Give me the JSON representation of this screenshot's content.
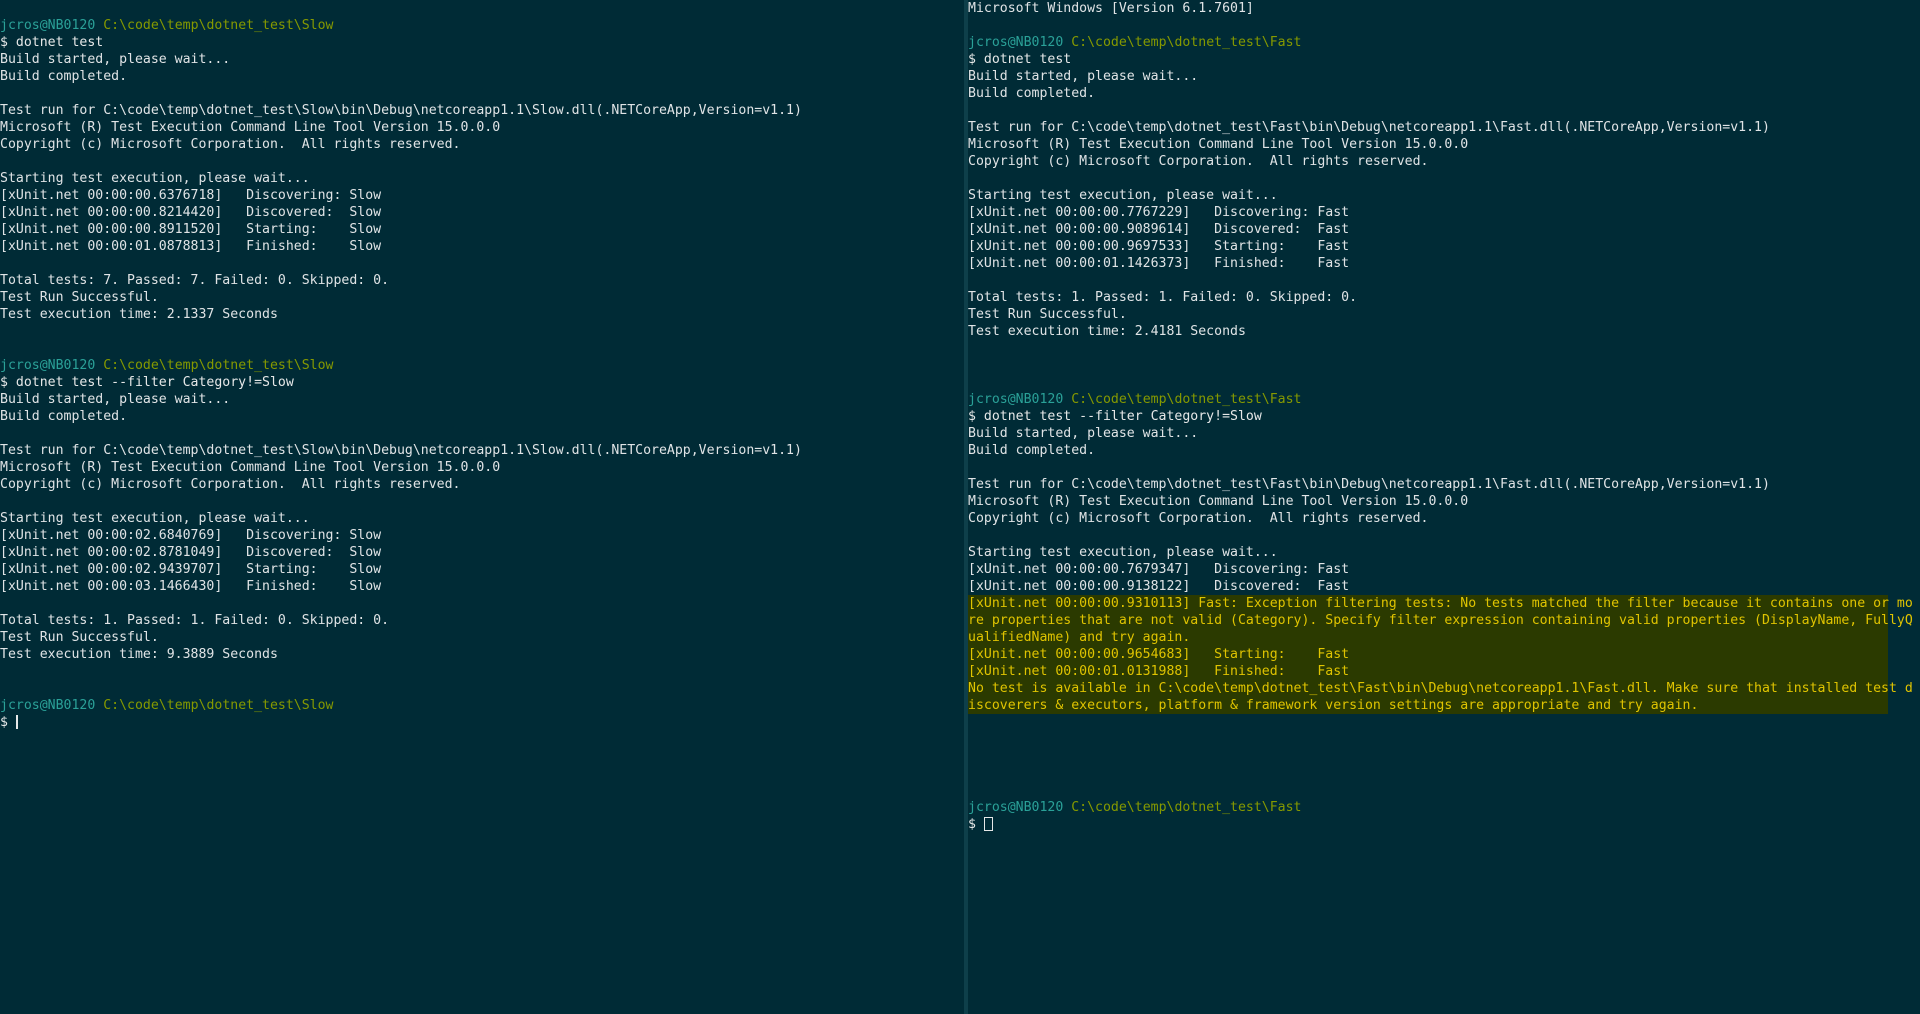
{
  "left": {
    "sessions": [
      {
        "user": "jcros@NB0120",
        "path": "C:\\code\\temp\\dotnet_test\\Slow",
        "command": "$ dotnet test",
        "output": [
          "Build started, please wait...",
          "Build completed.",
          "",
          "Test run for C:\\code\\temp\\dotnet_test\\Slow\\bin\\Debug\\netcoreapp1.1\\Slow.dll(.NETCoreApp,Version=v1.1)",
          "Microsoft (R) Test Execution Command Line Tool Version 15.0.0.0",
          "Copyright (c) Microsoft Corporation.  All rights reserved.",
          "",
          "Starting test execution, please wait...",
          "[xUnit.net 00:00:00.6376718]   Discovering: Slow",
          "[xUnit.net 00:00:00.8214420]   Discovered:  Slow",
          "[xUnit.net 00:00:00.8911520]   Starting:    Slow",
          "[xUnit.net 00:00:01.0878813]   Finished:    Slow",
          "",
          "Total tests: 7. Passed: 7. Failed: 0. Skipped: 0.",
          "Test Run Successful.",
          "Test execution time: 2.1337 Seconds",
          "",
          ""
        ]
      },
      {
        "user": "jcros@NB0120",
        "path": "C:\\code\\temp\\dotnet_test\\Slow",
        "command": "$ dotnet test --filter Category!=Slow",
        "output": [
          "Build started, please wait...",
          "Build completed.",
          "",
          "Test run for C:\\code\\temp\\dotnet_test\\Slow\\bin\\Debug\\netcoreapp1.1\\Slow.dll(.NETCoreApp,Version=v1.1)",
          "Microsoft (R) Test Execution Command Line Tool Version 15.0.0.0",
          "Copyright (c) Microsoft Corporation.  All rights reserved.",
          "",
          "Starting test execution, please wait...",
          "[xUnit.net 00:00:02.6840769]   Discovering: Slow",
          "[xUnit.net 00:00:02.8781049]   Discovered:  Slow",
          "[xUnit.net 00:00:02.9439707]   Starting:    Slow",
          "[xUnit.net 00:00:03.1466430]   Finished:    Slow",
          "",
          "Total tests: 1. Passed: 1. Failed: 0. Skipped: 0.",
          "Test Run Successful.",
          "Test execution time: 9.3889 Seconds",
          "",
          ""
        ]
      }
    ],
    "final_user": "jcros@NB0120",
    "final_path": "C:\\code\\temp\\dotnet_test\\Slow",
    "final_prompt": "$ "
  },
  "right": {
    "header": "Microsoft Windows [Version 6.1.7601]",
    "sessions": [
      {
        "user": "jcros@NB0120",
        "path": "C:\\code\\temp\\dotnet_test\\Fast",
        "command": "$ dotnet test",
        "output": [
          "Build started, please wait...",
          "Build completed.",
          "",
          "Test run for C:\\code\\temp\\dotnet_test\\Fast\\bin\\Debug\\netcoreapp1.1\\Fast.dll(.NETCoreApp,Version=v1.1)",
          "Microsoft (R) Test Execution Command Line Tool Version 15.0.0.0",
          "Copyright (c) Microsoft Corporation.  All rights reserved.",
          "",
          "Starting test execution, please wait...",
          "[xUnit.net 00:00:00.7767229]   Discovering: Fast",
          "[xUnit.net 00:00:00.9089614]   Discovered:  Fast",
          "[xUnit.net 00:00:00.9697533]   Starting:    Fast",
          "[xUnit.net 00:00:01.1426373]   Finished:    Fast",
          "",
          "Total tests: 1. Passed: 1. Failed: 0. Skipped: 0.",
          "Test Run Successful.",
          "Test execution time: 2.4181 Seconds",
          "",
          "",
          ""
        ]
      }
    ],
    "second": {
      "user": "jcros@NB0120",
      "path": "C:\\code\\temp\\dotnet_test\\Fast",
      "command": "$ dotnet test --filter Category!=Slow",
      "output": [
        "Build started, please wait...",
        "Build completed.",
        "",
        "Test run for C:\\code\\temp\\dotnet_test\\Fast\\bin\\Debug\\netcoreapp1.1\\Fast.dll(.NETCoreApp,Version=v1.1)",
        "Microsoft (R) Test Execution Command Line Tool Version 15.0.0.0",
        "Copyright (c) Microsoft Corporation.  All rights reserved.",
        "",
        "Starting test execution, please wait...",
        "[xUnit.net 00:00:00.7679347]   Discovering: Fast",
        "[xUnit.net 00:00:00.9138122]   Discovered:  Fast"
      ],
      "warnings": [
        "[xUnit.net 00:00:00.9310113] Fast: Exception filtering tests: No tests matched the filter because it contains one or mo",
        "re properties that are not valid (Category). Specify filter expression containing valid properties (DisplayName, FullyQ",
        "ualifiedName) and try again.",
        "[xUnit.net 00:00:00.9654683]   Starting:    Fast",
        "[xUnit.net 00:00:01.0131988]   Finished:    Fast",
        "No test is available in C:\\code\\temp\\dotnet_test\\Fast\\bin\\Debug\\netcoreapp1.1\\Fast.dll. Make sure that installed test d",
        "iscoverers & executors, platform & framework version settings are appropriate and try again."
      ],
      "after": [
        "",
        "",
        "",
        "",
        ""
      ]
    },
    "final_user": "jcros@NB0120",
    "final_path": "C:\\code\\temp\\dotnet_test\\Fast",
    "final_prompt": "$ "
  }
}
